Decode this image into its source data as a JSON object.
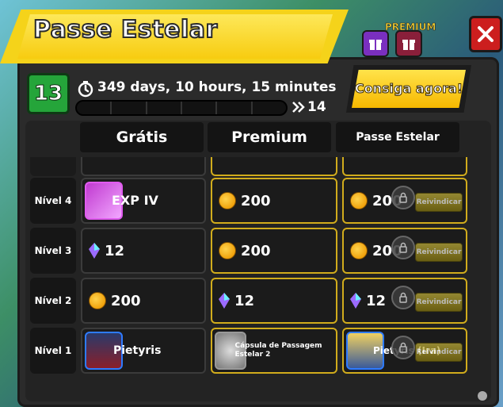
{
  "window": {
    "title": "Passe Estelar",
    "premium_label": "PREMIUM"
  },
  "header": {
    "level": "13",
    "timer": "349 days, 10 hours, 15 minutes",
    "next_level": "14",
    "buy_button": "Consiga agora!"
  },
  "tabs": [
    "Grátis",
    "Premium",
    "Passe Estelar"
  ],
  "rows": [
    {
      "level": "Nível 4",
      "free": {
        "type": "exp",
        "label": "EXP IV"
      },
      "premium": {
        "type": "coin",
        "value": "200"
      },
      "star": {
        "type": "coin",
        "value": "200",
        "claim": "Reivindicar"
      }
    },
    {
      "level": "Nível 3",
      "free": {
        "type": "crystal",
        "value": "12"
      },
      "premium": {
        "type": "coin",
        "value": "200"
      },
      "star": {
        "type": "coin",
        "value": "200",
        "claim": "Reivindicar"
      }
    },
    {
      "level": "Nível 2",
      "free": {
        "type": "coin",
        "value": "200"
      },
      "premium": {
        "type": "crystal",
        "value": "12"
      },
      "star": {
        "type": "crystal",
        "value": "12",
        "claim": "Reivindicar"
      }
    },
    {
      "level": "Nível 1",
      "free": {
        "type": "character",
        "value": "Pietyris"
      },
      "premium": {
        "type": "capsule",
        "value": "Cápsula de Passagem Estelar 2"
      },
      "star": {
        "type": "character",
        "value": "Pietyris (Ira)",
        "claim": "Reivindicar"
      }
    }
  ],
  "colors": {
    "banner_yellow": "#f7cc10",
    "level_green": "#25a53a",
    "close_red": "#cc1e1e",
    "premium_border": "#d1ac1c"
  }
}
